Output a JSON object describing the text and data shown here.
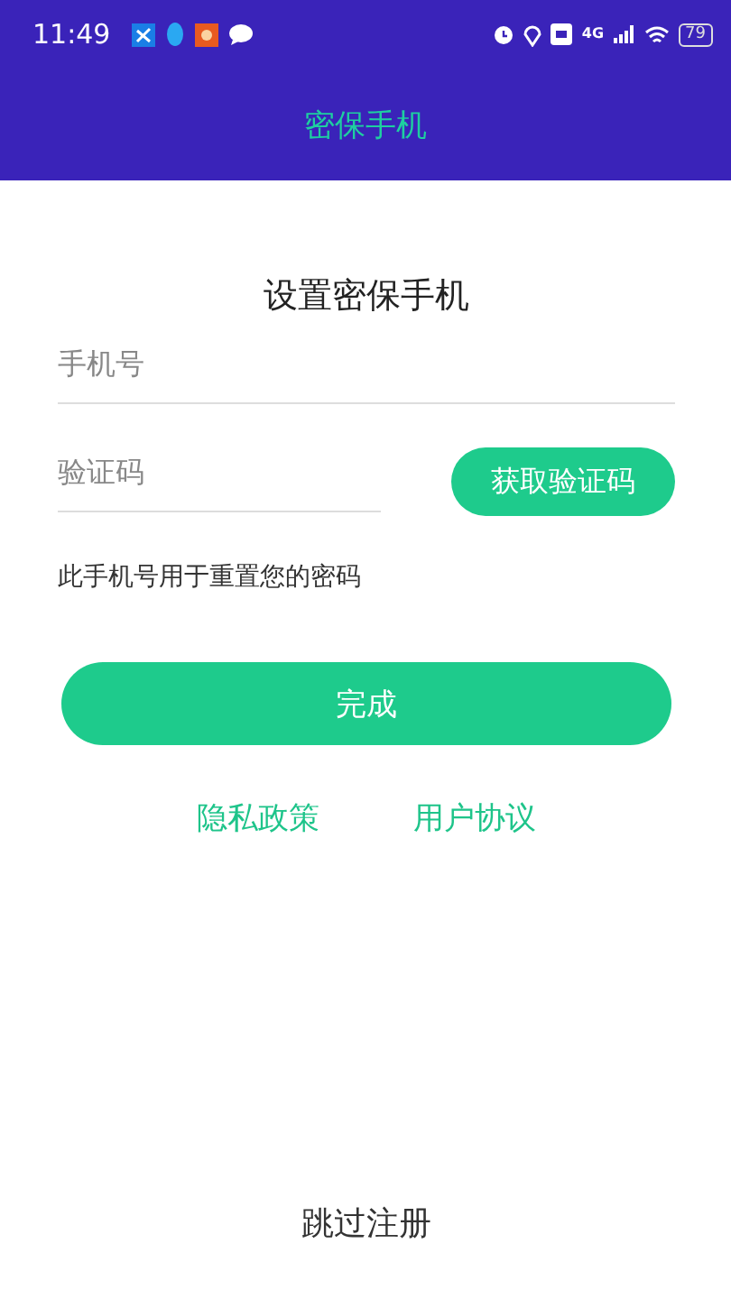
{
  "status_bar": {
    "time": "11:49",
    "network": "4G",
    "battery": "79"
  },
  "app_bar": {
    "title": "密保手机"
  },
  "form": {
    "heading": "设置密保手机",
    "phone_field": {
      "placeholder": "手机号"
    },
    "code_field": {
      "placeholder": "验证码"
    },
    "get_code_button": "获取验证码",
    "note": "此手机号用于重置您的密码",
    "submit_button": "完成",
    "links": [
      "隐私政策",
      "用户协议"
    ]
  },
  "skip_link": "跳过注册"
}
